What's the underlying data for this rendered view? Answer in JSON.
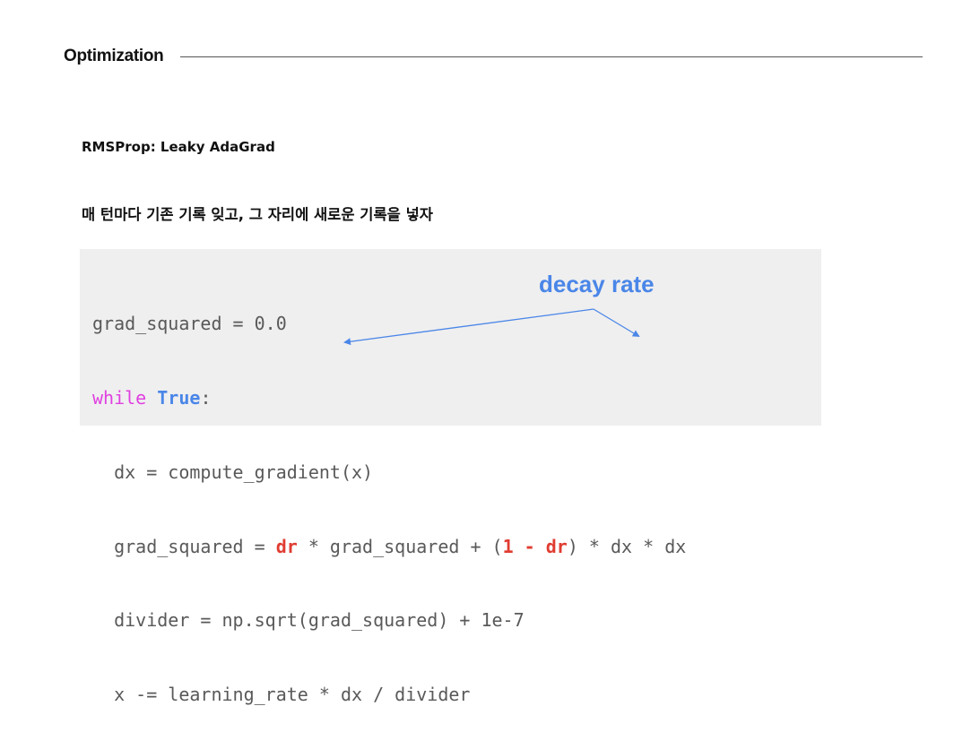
{
  "header": {
    "title": "Optimization"
  },
  "slide": {
    "subtitle": "RMSProp: Leaky AdaGrad",
    "description": "매 턴마다 기존 기록 잊고, 그 자리에 새로운 기록을 넣자"
  },
  "code": {
    "line1": "grad_squared = 0.0",
    "line2_kw": "while",
    "line2_sp": " ",
    "line2_true": "True",
    "line2_rest": ":",
    "line3": "  dx = compute_gradient(x)",
    "line4_a": "  grad_squared = ",
    "line4_dr1": "dr",
    "line4_b": " * grad_squared + (",
    "line4_one": "1 - dr",
    "line4_c": ") * dx * dx",
    "line5": "  divider = np.sqrt(grad_squared) + 1e-7",
    "line6": "  x -= learning_rate * dx / divider"
  },
  "annotation": {
    "label": "decay rate"
  },
  "colors": {
    "keyword_while": "#e040e0",
    "keyword_true": "#4a86e8",
    "highlight": "#e03c31",
    "annotation": "#4a86e8",
    "code_background": "#efefef"
  }
}
